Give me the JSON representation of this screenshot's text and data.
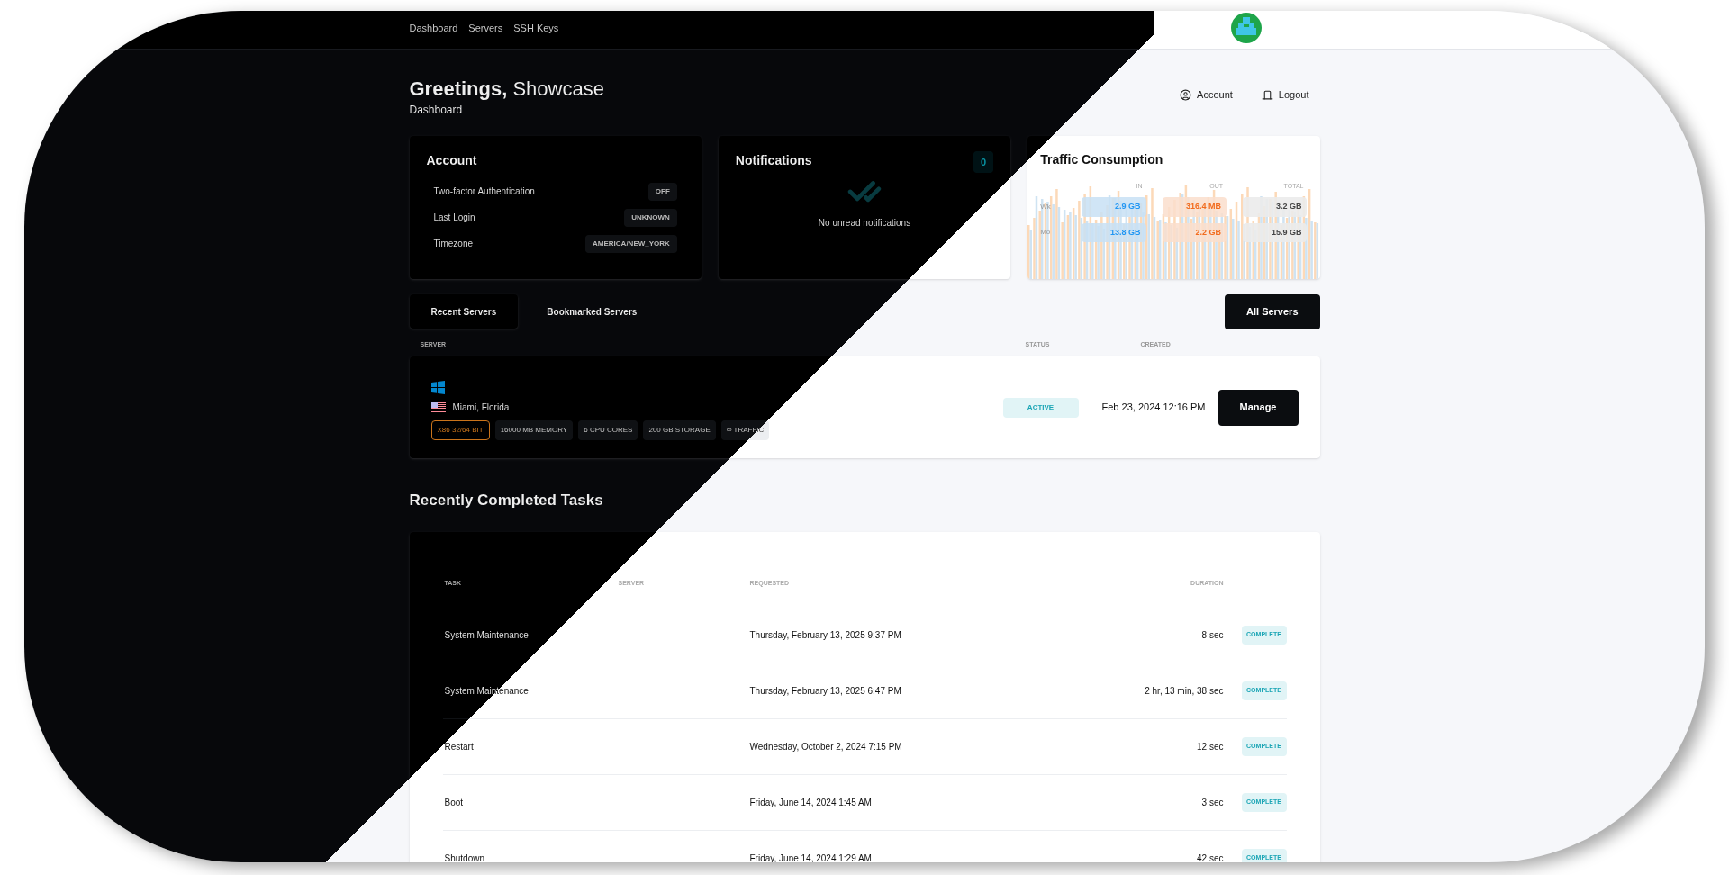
{
  "nav": {
    "links": [
      "Dashboard",
      "Servers",
      "SSH Keys"
    ]
  },
  "header": {
    "greeting": "Greetings,",
    "name": "Showcase",
    "subtitle": "Dashboard",
    "actions": [
      {
        "kind": "account",
        "label": "Account"
      },
      {
        "kind": "logout",
        "label": "Logout"
      }
    ]
  },
  "account_card": {
    "title": "Account",
    "rows": [
      {
        "label": "Two-factor Authentication",
        "value": "OFF"
      },
      {
        "label": "Last Login",
        "value": "UNKNOWN"
      },
      {
        "label": "Timezone",
        "value": "AMERICA/NEW_YORK"
      }
    ]
  },
  "notifications_card": {
    "title": "Notifications",
    "count": "0",
    "empty_text": "No unread notifications"
  },
  "traffic_card": {
    "title": "Traffic Consumption",
    "columns": [
      "IN",
      "OUT",
      "TOTAL"
    ],
    "rows": [
      {
        "label": "Wk",
        "in": "2.9 GB",
        "out": "316.4 MB",
        "total": "3.2 GB"
      },
      {
        "label": "Mo",
        "in": "13.8 GB",
        "out": "2.2 GB",
        "total": "15.9 GB"
      }
    ]
  },
  "server_tabs": [
    {
      "label": "Recent Servers",
      "selected": true
    },
    {
      "label": "Bookmarked Servers",
      "selected": false
    }
  ],
  "all_servers_button": "All Servers",
  "servers_table": {
    "columns": [
      "SERVER",
      "STATUS",
      "CREATED"
    ],
    "rows": [
      {
        "location": "Miami, Florida",
        "specs": [
          {
            "text": "X86 32/64 BIT",
            "kind": "arch"
          },
          {
            "text": "16000 MB MEMORY",
            "kind": "spec"
          },
          {
            "text": "6 CPU CORES",
            "kind": "spec"
          },
          {
            "text": "200 GB STORAGE",
            "kind": "spec"
          },
          {
            "text": "∞ TRAFFIC",
            "kind": "spec"
          }
        ],
        "status": "ACTIVE",
        "created": "Feb 23, 2024 12:16 PM",
        "action": "Manage"
      }
    ]
  },
  "tasks": {
    "title": "Recently Completed Tasks",
    "columns": [
      "TASK",
      "SERVER",
      "REQUESTED",
      "DURATION"
    ],
    "rows": [
      {
        "task": "System Maintenance",
        "requested": "Thursday, February 13, 2025 9:37 PM",
        "duration": "8 sec",
        "status": "COMPLETE"
      },
      {
        "task": "System Maintenance",
        "requested": "Thursday, February 13, 2025 6:47 PM",
        "duration": "2 hr, 13 min, 38 sec",
        "status": "COMPLETE"
      },
      {
        "task": "Restart",
        "requested": "Wednesday, October 2, 2024 7:15 PM",
        "duration": "12 sec",
        "status": "COMPLETE"
      },
      {
        "task": "Boot",
        "requested": "Friday, June 14, 2024 1:45 AM",
        "duration": "3 sec",
        "status": "COMPLETE"
      },
      {
        "task": "Shutdown",
        "requested": "Friday, June 14, 2024 1:29 AM",
        "duration": "42 sec",
        "status": "COMPLETE"
      }
    ]
  }
}
